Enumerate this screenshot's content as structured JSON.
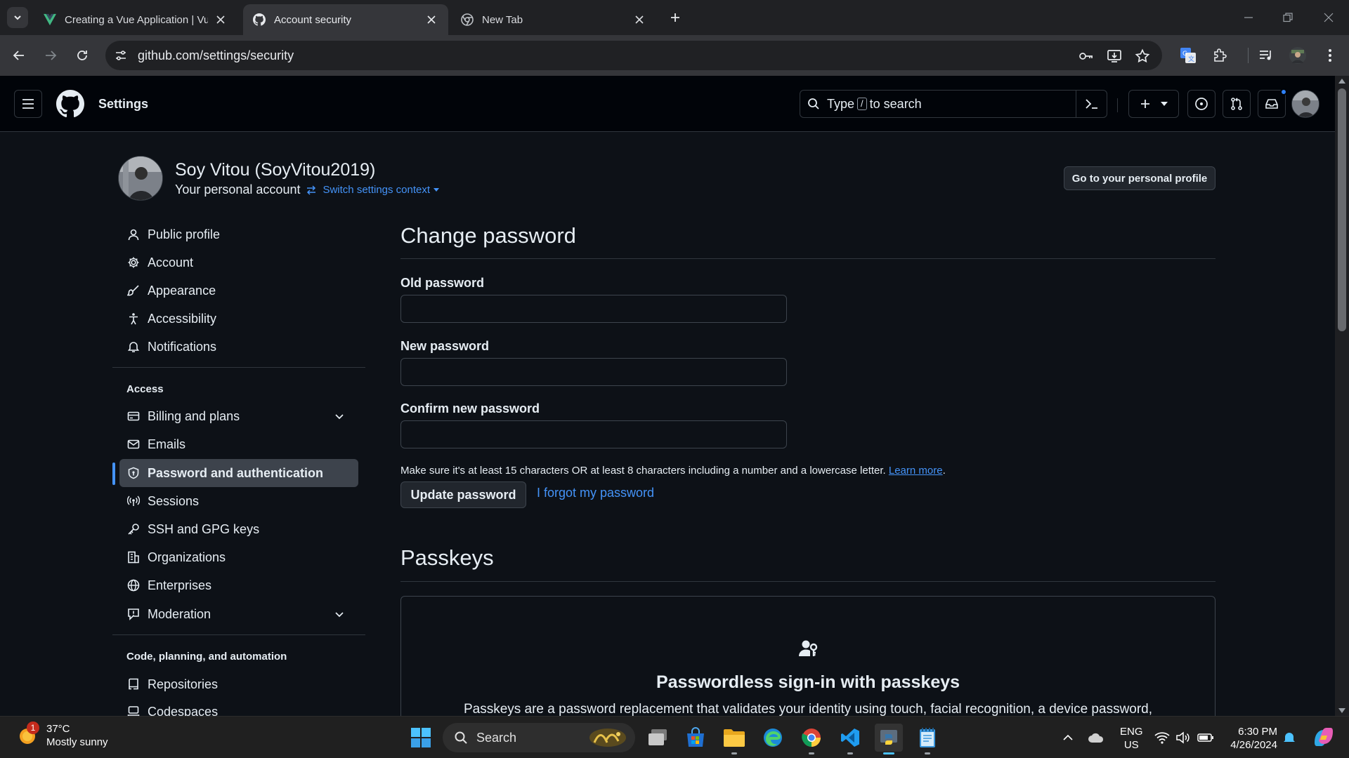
{
  "browser": {
    "tabs": [
      {
        "title": "Creating a Vue Application | Vue.js",
        "active": false
      },
      {
        "title": "Account security",
        "active": true
      },
      {
        "title": "New Tab",
        "active": false
      }
    ],
    "url": "github.com/settings/security"
  },
  "header": {
    "context": "Settings",
    "search_prefix": "Type",
    "search_key": "/",
    "search_suffix": "to search"
  },
  "profile": {
    "name": "Soy Vitou (SoyVitou2019)",
    "account_label": "Your personal account",
    "switch_context": "Switch settings context",
    "go_profile_button": "Go to your personal profile"
  },
  "sidebar": {
    "items": [
      {
        "label": "Public profile",
        "icon": "person-icon"
      },
      {
        "label": "Account",
        "icon": "gear-icon"
      },
      {
        "label": "Appearance",
        "icon": "paintbrush-icon"
      },
      {
        "label": "Accessibility",
        "icon": "accessibility-icon"
      },
      {
        "label": "Notifications",
        "icon": "bell-icon"
      }
    ],
    "access_heading": "Access",
    "access_items": [
      {
        "label": "Billing and plans",
        "icon": "credit-card-icon",
        "expandable": true
      },
      {
        "label": "Emails",
        "icon": "mail-icon"
      },
      {
        "label": "Password and authentication",
        "icon": "shield-lock-icon",
        "active": true
      },
      {
        "label": "Sessions",
        "icon": "broadcast-icon"
      },
      {
        "label": "SSH and GPG keys",
        "icon": "key-icon"
      },
      {
        "label": "Organizations",
        "icon": "organization-icon"
      },
      {
        "label": "Enterprises",
        "icon": "globe-icon"
      },
      {
        "label": "Moderation",
        "icon": "report-icon",
        "expandable": true
      }
    ],
    "code_heading": "Code, planning, and automation",
    "code_items": [
      {
        "label": "Repositories",
        "icon": "repo-icon"
      },
      {
        "label": "Codespaces",
        "icon": "codespaces-icon"
      }
    ]
  },
  "change_password": {
    "title": "Change password",
    "old_label": "Old password",
    "new_label": "New password",
    "confirm_label": "Confirm new password",
    "hint": "Make sure it's at least 15 characters OR at least 8 characters including a number and a lowercase letter.",
    "learn_more": "Learn more",
    "update_button": "Update password",
    "forgot_link": "I forgot my password"
  },
  "passkeys": {
    "title": "Passkeys",
    "box_title": "Passwordless sign-in with passkeys",
    "box_desc": "Passkeys are a password replacement that validates your identity using touch, facial recognition, a device password,"
  },
  "taskbar": {
    "weather_temp": "37°C",
    "weather_desc": "Mostly sunny",
    "weather_badge": "1",
    "search_label": "Search",
    "lang_line1": "ENG",
    "lang_line2": "US",
    "time": "6:30 PM",
    "date": "4/26/2024"
  },
  "colors": {
    "accent": "#4493f8",
    "page_bg": "#0d1117",
    "header_bg": "#010409",
    "border": "#30363d"
  }
}
